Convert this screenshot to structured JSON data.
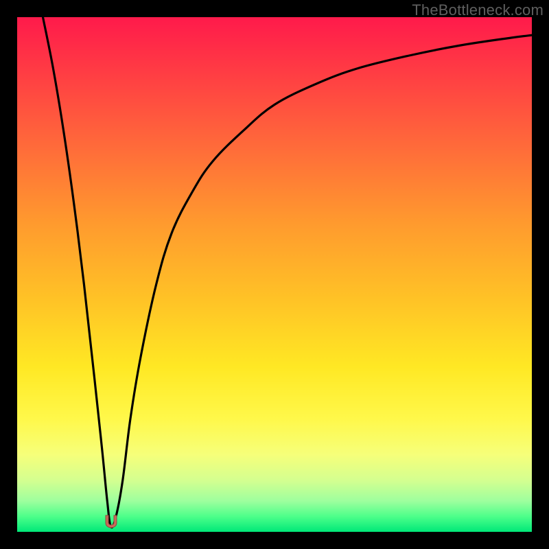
{
  "watermark": "TheBottleneck.com",
  "colors": {
    "frame": "#000000",
    "curve_stroke": "#000000",
    "marker_fill": "#c96a5a",
    "marker_stroke": "#8e4a3e",
    "watermark_text": "#5f5f5f"
  },
  "chart_data": {
    "type": "line",
    "title": "",
    "xlabel": "",
    "ylabel": "",
    "xlim": [
      0,
      100
    ],
    "ylim": [
      0,
      100
    ],
    "grid": false,
    "legend": false,
    "series": [
      {
        "name": "bottleneck-curve",
        "x": [
          5,
          7,
          9,
          11,
          13,
          15,
          16.5,
          17.5,
          18.2,
          19.2,
          20.5,
          22,
          24,
          27,
          30,
          34,
          38,
          44,
          50,
          58,
          66,
          76,
          86,
          96,
          100
        ],
        "y": [
          100,
          90,
          78,
          64,
          48,
          30,
          16,
          6,
          1,
          3,
          10,
          22,
          34,
          48,
          58,
          66,
          72,
          78,
          83,
          87,
          90,
          92.5,
          94.5,
          96,
          96.5
        ]
      }
    ],
    "dip": {
      "x": 18.2,
      "y": 1
    }
  }
}
